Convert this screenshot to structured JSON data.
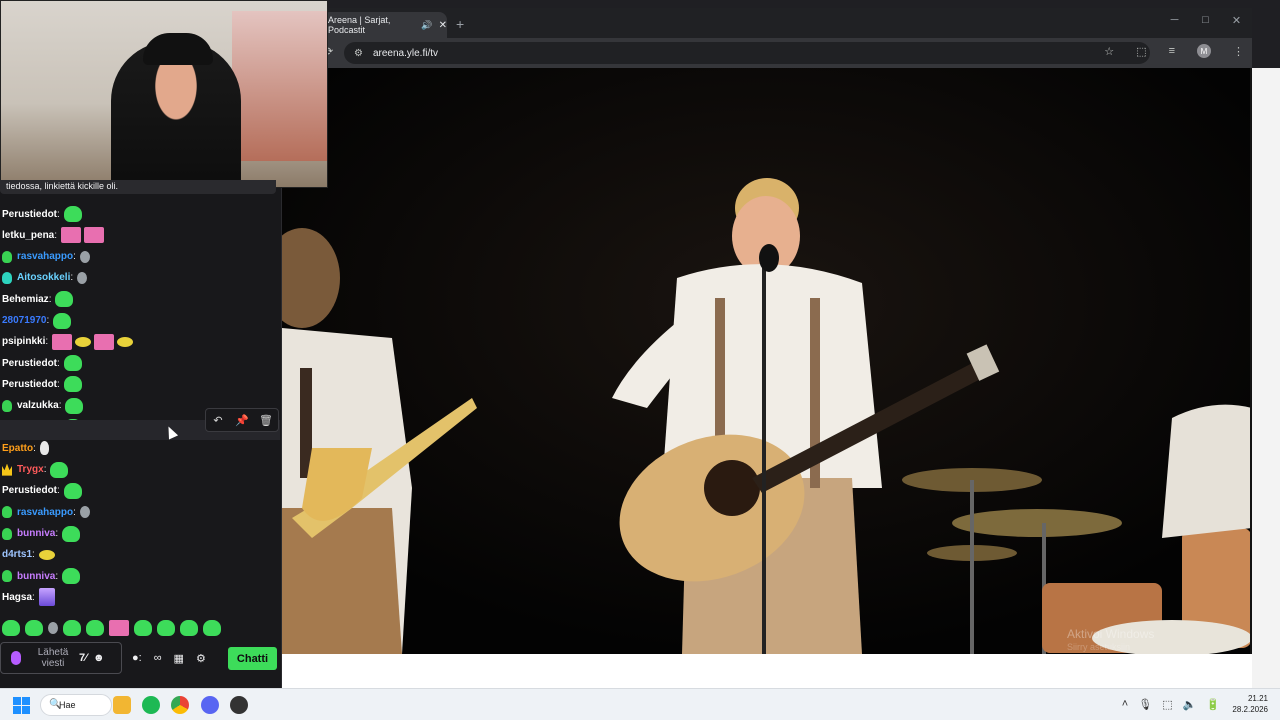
{
  "colors": {
    "chat_bg": "#18181b",
    "chat_accent": "#3ddc5a",
    "browser_chrome": "#35363a",
    "taskbar": "#eef2f6"
  },
  "chat": {
    "webcam_caption": "tiedossa, linkiettä kickille oli.",
    "messages": [
      {
        "user": "Perustiedot",
        "color": "#ffffff",
        "badge": "none",
        "emotes": [
          "green"
        ]
      },
      {
        "user": "letku_pena",
        "color": "#ffffff",
        "badge": "none",
        "emotes": [
          "pink",
          "pink"
        ]
      },
      {
        "user": "rasvahappo",
        "color": "#3a9bff",
        "badge": "green",
        "emotes": [
          "grey"
        ]
      },
      {
        "user": "Aitosokkeli",
        "color": "#6ad2ff",
        "badge": "teal",
        "emotes": [
          "grey"
        ]
      },
      {
        "user": "Behemiaz",
        "color": "#ffffff",
        "badge": "none",
        "emotes": [
          "green"
        ]
      },
      {
        "user": "28071970",
        "color": "#3a7bff",
        "badge": "none",
        "emotes": [
          "green"
        ]
      },
      {
        "user": "psipinkki",
        "color": "#ffffff",
        "badge": "none",
        "emotes": [
          "pink",
          "yellow",
          "pink",
          "yellow"
        ]
      },
      {
        "user": "Perustiedot",
        "color": "#ffffff",
        "badge": "none",
        "emotes": [
          "green"
        ]
      },
      {
        "user": "Perustiedot",
        "color": "#ffffff",
        "badge": "none",
        "emotes": [
          "green"
        ]
      },
      {
        "user": "valzukka",
        "color": "#ffffff",
        "badge": "green",
        "emotes": [
          "green"
        ]
      },
      {
        "user": "Perustiedot",
        "color": "#ffffff",
        "badge": "none",
        "emotes": [
          "green"
        ]
      },
      {
        "user": "Epatto",
        "color": "#ff9f1a",
        "badge": "none",
        "emotes": [
          "white"
        ]
      },
      {
        "user": "Trygx",
        "color": "#ff5b5b",
        "badge": "crown",
        "emotes": [
          "green"
        ]
      },
      {
        "user": "Perustiedot",
        "color": "#ffffff",
        "badge": "none",
        "emotes": [
          "green"
        ]
      },
      {
        "user": "rasvahappo",
        "color": "#3a9bff",
        "badge": "green",
        "emotes": [
          "grey"
        ]
      },
      {
        "user": "bunniva",
        "color": "#c77dff",
        "badge": "green",
        "emotes": [
          "green"
        ]
      },
      {
        "user": "d4rts1",
        "color": "#9ec5ff",
        "badge": "none",
        "emotes": [
          "yellow"
        ]
      },
      {
        "user": "bunniva",
        "color": "#c77dff",
        "badge": "green",
        "emotes": [
          "green"
        ]
      },
      {
        "user": "Hagsa",
        "color": "#ffffff",
        "badge": "none",
        "emotes": [
          "purple"
        ]
      }
    ],
    "message_actions": [
      "↶",
      "📌",
      "🗑"
    ],
    "emote_bar": [
      "green",
      "green",
      "grey",
      "green",
      "green",
      "pink",
      "green",
      "green",
      "green",
      "green"
    ],
    "input_placeholder": "Lähetä viesti",
    "input_icons": [
      "7⁄",
      "☻"
    ],
    "tool_icons": [
      "●:",
      "∞",
      "▦",
      "⚙"
    ],
    "send_label": "Chatti"
  },
  "browser": {
    "tab_title": "Areena | Sarjat, Podcastit",
    "tab_speaker": "🔊",
    "tab_close": "✕",
    "new_tab": "+",
    "window_controls": [
      "─",
      "□",
      "✕"
    ],
    "reload_icon": "⟳",
    "site_info_icon": "⚙",
    "url": "areena.yle.fi/tv",
    "toolbar_icons": [
      "☆",
      "⬚",
      "≡"
    ],
    "avatar_letter": "M"
  },
  "video": {
    "watermark_line1": "Aktivoi Windows",
    "watermark_line2": "Siirry asetuksiin"
  },
  "taskbar": {
    "search_label": "Hae",
    "search_icon": "🔍",
    "tray_icons": [
      "˄",
      "🎙",
      "⬚",
      "🔈",
      "🔋"
    ],
    "time": "21.21",
    "date": "28.2.2026"
  }
}
